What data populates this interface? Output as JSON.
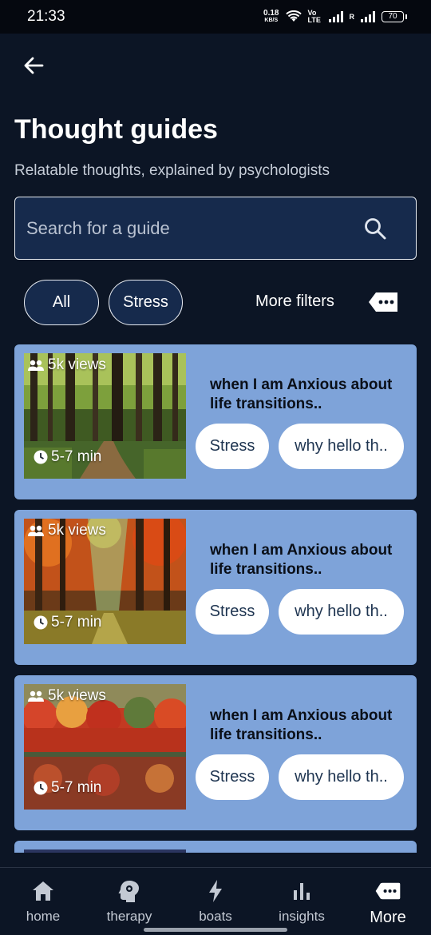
{
  "status_bar": {
    "time": "21:33",
    "net_speed_value": "0.18",
    "net_speed_unit": "KB/S",
    "volte": "Vo LTE",
    "roaming": "R",
    "battery": "70"
  },
  "header": {
    "title": "Thought guides",
    "subtitle": "Relatable thoughts, explained by psychologists"
  },
  "search": {
    "placeholder": "Search for a guide"
  },
  "filters": {
    "chips": [
      "All",
      "Stress"
    ],
    "more_label": "More filters"
  },
  "cards": [
    {
      "views": "5k views",
      "duration": "5-7 min",
      "title": "when I am Anxious about life transitions..",
      "tags": [
        "Stress",
        "why hello th.."
      ],
      "image": "green-forest-path"
    },
    {
      "views": "5k views",
      "duration": "5-7 min",
      "title": "when I am Anxious about life transitions..",
      "tags": [
        "Stress",
        "why hello th.."
      ],
      "image": "autumn-forest-sunbeam"
    },
    {
      "views": "5k views",
      "duration": "5-7 min",
      "title": "when I am Anxious about life transitions..",
      "tags": [
        "Stress",
        "why hello th.."
      ],
      "image": "autumn-lake-reflection"
    }
  ],
  "bottom_nav": {
    "items": [
      {
        "label": "home",
        "icon": "home-icon"
      },
      {
        "label": "therapy",
        "icon": "head-gear-icon"
      },
      {
        "label": "boats",
        "icon": "lightning-icon"
      },
      {
        "label": "insights",
        "icon": "bar-chart-icon"
      },
      {
        "label": "More",
        "icon": "more-tag-icon",
        "active": true
      }
    ]
  },
  "colors": {
    "background": "#0c1525",
    "card": "#7ea3d9",
    "chip_bg": "#162a4c"
  }
}
